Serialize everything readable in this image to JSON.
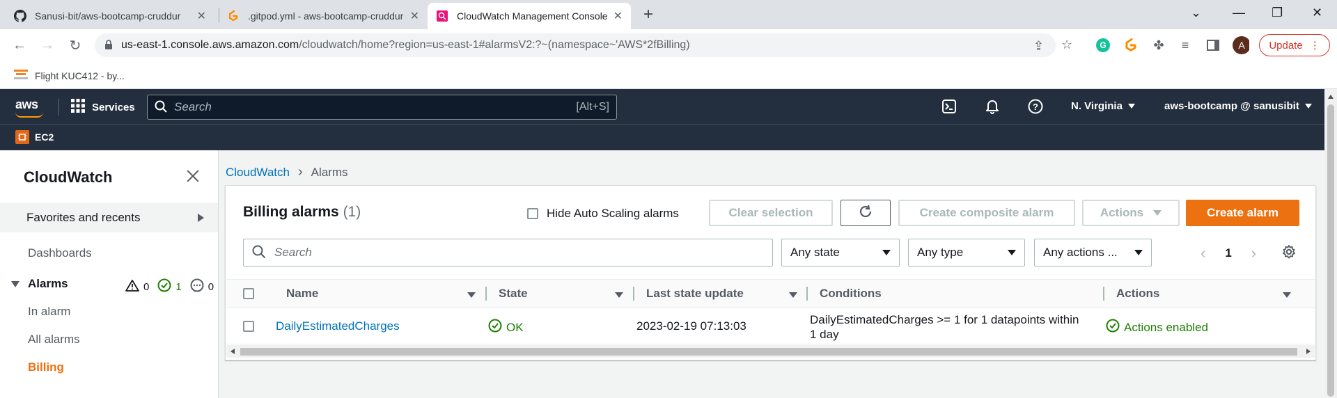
{
  "browser": {
    "tabs": [
      {
        "title": "Sanusi-bit/aws-bootcamp-cruddur",
        "icon": "github-icon"
      },
      {
        "title": ".gitpod.yml - aws-bootcamp-cruddur",
        "icon": "gitpod-icon"
      },
      {
        "title": "CloudWatch Management Console",
        "icon": "cloudwatch-icon"
      }
    ],
    "url_host": "us-east-1.console.aws.amazon.com",
    "url_path": "/cloudwatch/home?region=us-east-1#alarmsV2:?~(namespace~'AWS*2fBilling)",
    "profile_initial": "A",
    "update_label": "Update",
    "bookmark": "Flight KUC412 - by..."
  },
  "aws_nav": {
    "logo": "aws",
    "services_label": "Services",
    "search_placeholder": "Search",
    "search_shortcut": "[Alt+S]",
    "region": "N. Virginia",
    "account": "aws-bootcamp @ sanusibit",
    "favorite_service": "EC2"
  },
  "sidebar": {
    "title": "CloudWatch",
    "favorites": "Favorites and recents",
    "dashboards": "Dashboards",
    "alarms": "Alarms",
    "alarm_counts": {
      "in_alarm": "0",
      "ok": "1",
      "insufficient": "0"
    },
    "in_alarm": "In alarm",
    "all_alarms": "All alarms",
    "billing": "Billing"
  },
  "breadcrumb": {
    "root": "CloudWatch",
    "current": "Alarms"
  },
  "panel": {
    "title": "Billing alarms",
    "count": "(1)",
    "hide_auto_scaling": "Hide Auto Scaling alarms",
    "clear_selection": "Clear selection",
    "create_composite": "Create composite alarm",
    "actions": "Actions",
    "create_alarm": "Create alarm",
    "search_placeholder": "Search",
    "filter_state": "Any state",
    "filter_type": "Any type",
    "filter_actions": "Any actions ...",
    "page": "1",
    "columns": [
      "Name",
      "State",
      "Last state update",
      "Conditions",
      "Actions"
    ],
    "rows": [
      {
        "name": "DailyEstimatedCharges",
        "state": "OK",
        "last_update": "2023-02-19 07:13:03",
        "conditions_line1": "DailyEstimatedCharges >= 1 for 1 datapoints within",
        "conditions_line2": "1 day",
        "actions": "Actions enabled"
      }
    ]
  },
  "colors": {
    "aws_nav": "#232f3e",
    "primary": "#ec7211",
    "link": "#0073bb",
    "ok": "#1d8102"
  }
}
